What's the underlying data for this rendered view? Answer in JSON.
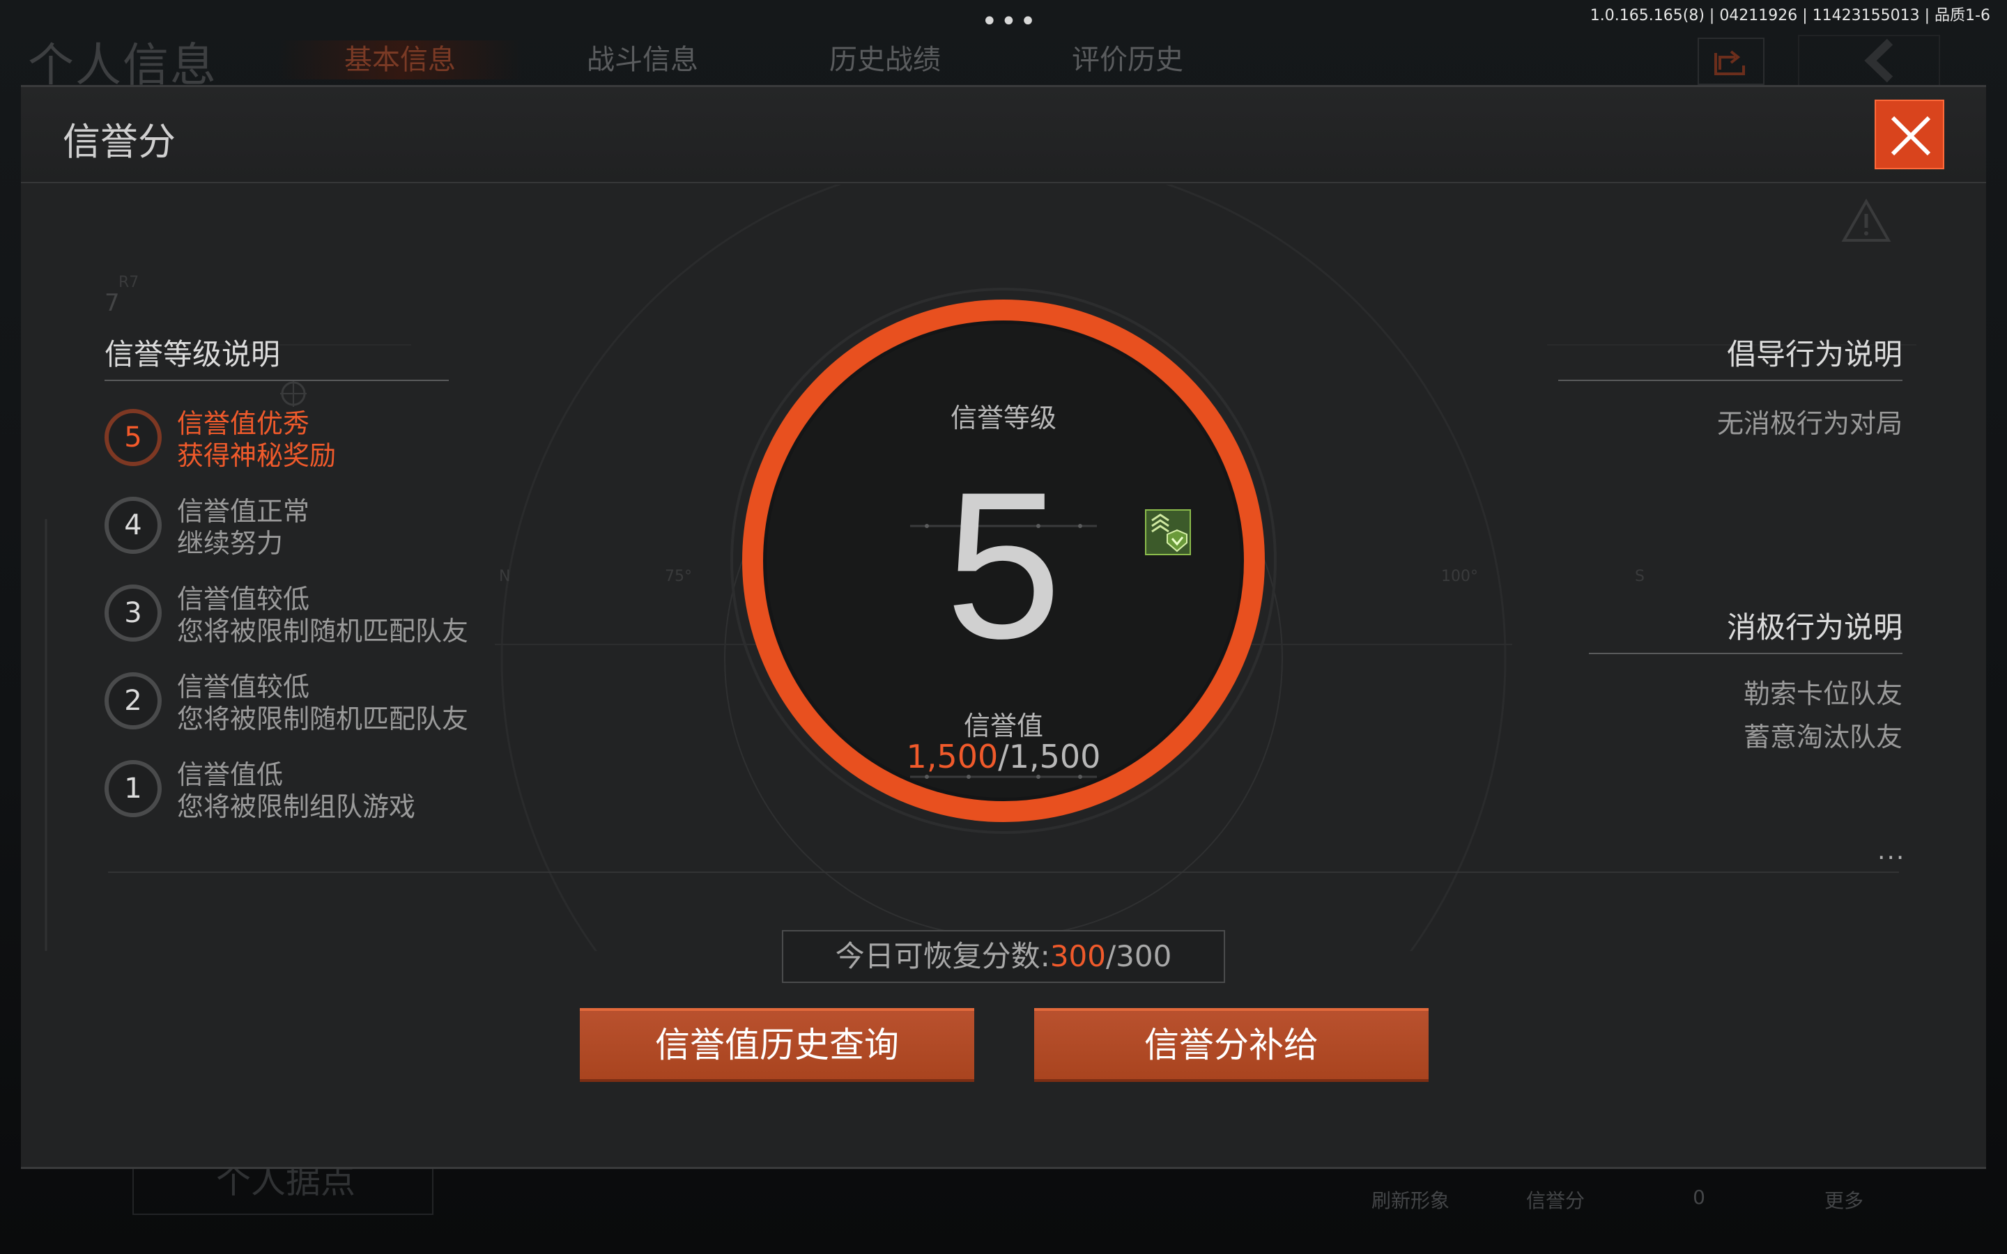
{
  "system": {
    "version": "1.0.165.165(8) | 04211926 | 11423155013 | 品质1-6",
    "dots": "•••"
  },
  "background": {
    "title": "个人信息",
    "tabs": [
      "基本信息",
      "战斗信息",
      "历史战绩",
      "评价历史"
    ],
    "bottom_button": "个人据点",
    "footer": [
      "刷新形象",
      "信誉分",
      "0",
      "更多"
    ]
  },
  "modal": {
    "title": "信誉分",
    "compass": {
      "n": "N",
      "d75": "75°",
      "d100": "100°",
      "s": "S",
      "r7": "R7",
      "seven": "7"
    },
    "levels_heading": "信誉等级说明",
    "levels": [
      {
        "num": "5",
        "line1": "信誉值优秀",
        "line2": "获得神秘奖励",
        "active": true
      },
      {
        "num": "4",
        "line1": "信誉值正常",
        "line2": "继续努力",
        "active": false
      },
      {
        "num": "3",
        "line1": "信誉值较低",
        "line2": "您将被限制随机匹配队友",
        "active": false
      },
      {
        "num": "2",
        "line1": "信誉值较低",
        "line2": "您将被限制随机匹配队友",
        "active": false
      },
      {
        "num": "1",
        "line1": "信誉值低",
        "line2": "您将被限制组队游戏",
        "active": false
      }
    ],
    "gauge": {
      "level_label": "信誉等级",
      "level": "5",
      "value_label": "信誉值",
      "current": "1,500",
      "max": "/1,500"
    },
    "positive": {
      "heading": "倡导行为说明",
      "items": [
        "无消极行为对局"
      ],
      "more": "..."
    },
    "negative": {
      "heading": "消极行为说明",
      "items": [
        "勒索卡位队友",
        "蓄意淘汰队友"
      ],
      "more": "..."
    },
    "recover": {
      "label": "今日可恢复分数:",
      "current": "300",
      "max": "/300"
    },
    "buttons": {
      "history": "信誉值历史查询",
      "supply": "信誉分补给"
    }
  },
  "colors": {
    "accent": "#f05a2b",
    "ring": "#e8501f",
    "button": "#b34a27",
    "panel": "#222324"
  }
}
